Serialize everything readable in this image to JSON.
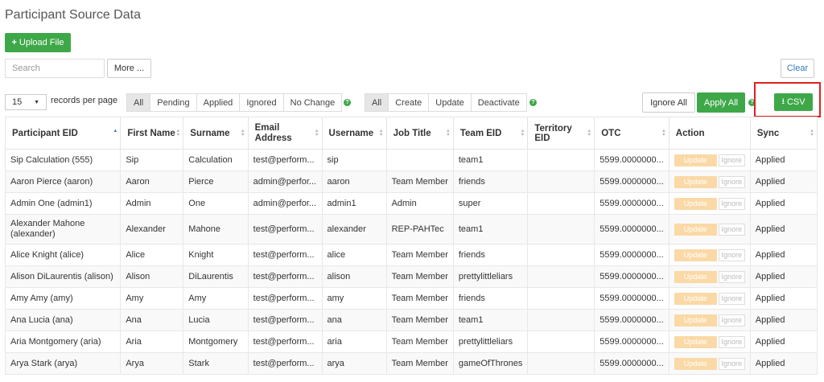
{
  "page": {
    "title": "Participant Source Data"
  },
  "toolbar": {
    "upload_label": "Upload File",
    "search_placeholder": "Search",
    "more_label": "More ...",
    "clear_label": "Clear"
  },
  "pager": {
    "records_value": "15",
    "records_label": "records per page"
  },
  "status_filters": [
    "All",
    "Pending",
    "Applied",
    "Ignored",
    "No Change"
  ],
  "action_filters": [
    "All",
    "Create",
    "Update",
    "Deactivate"
  ],
  "actions": {
    "ignore_all": "Ignore All",
    "apply_all": "Apply All",
    "csv": "CSV"
  },
  "table": {
    "columns": [
      "Participant EID",
      "First Name",
      "Surname",
      "Email Address",
      "Username",
      "Job Title",
      "Team EID",
      "Territory EID",
      "OTC",
      "Action",
      "Sync"
    ],
    "row_update_label": "Update",
    "row_ignore_label": "Ignore",
    "rows": [
      [
        "Sip Calculation (555)",
        "Sip",
        "Calculation",
        "test@perform...",
        "sip",
        "",
        "team1",
        "",
        "5599.0000000...",
        "Applied"
      ],
      [
        "Aaron Pierce (aaron)",
        "Aaron",
        "Pierce",
        "admin@perfor...",
        "aaron",
        "Team Member",
        "friends",
        "",
        "5599.0000000...",
        "Applied"
      ],
      [
        "Admin One (admin1)",
        "Admin",
        "One",
        "admin@perfor...",
        "admin1",
        "Admin",
        "super",
        "",
        "5599.0000000...",
        "Applied"
      ],
      [
        "Alexander Mahone (alexander)",
        "Alexander",
        "Mahone",
        "test@perform...",
        "alexander",
        "REP-PAHTec",
        "team1",
        "",
        "5599.0000000...",
        "Applied"
      ],
      [
        "Alice Knight (alice)",
        "Alice",
        "Knight",
        "test@perform...",
        "alice",
        "Team Member",
        "friends",
        "",
        "5599.0000000...",
        "Applied"
      ],
      [
        "Alison DiLaurentis (alison)",
        "Alison",
        "DiLaurentis",
        "test@perform...",
        "alison",
        "Team Member",
        "prettylittleliars",
        "",
        "5599.0000000...",
        "Applied"
      ],
      [
        "Amy Amy (amy)",
        "Amy",
        "Amy",
        "test@perform...",
        "amy",
        "Team Member",
        "friends",
        "",
        "5599.0000000...",
        "Applied"
      ],
      [
        "Ana Lucia (ana)",
        "Ana",
        "Lucia",
        "test@perform...",
        "ana",
        "Team Member",
        "team1",
        "",
        "5599.0000000...",
        "Applied"
      ],
      [
        "Aria Montgomery (aria)",
        "Aria",
        "Montgomery",
        "test@perform...",
        "aria",
        "Team Member",
        "prettylittleliars",
        "",
        "5599.0000000...",
        "Applied"
      ],
      [
        "Arya Stark (arya)",
        "Arya",
        "Stark",
        "test@perform...",
        "arya",
        "Team Member",
        "gameOfThrones",
        "",
        "5599.0000000...",
        "Applied"
      ]
    ]
  },
  "colors": {
    "accent": "#3ea849",
    "highlight": "#e02020",
    "update_disabled": "#fad9a6"
  }
}
